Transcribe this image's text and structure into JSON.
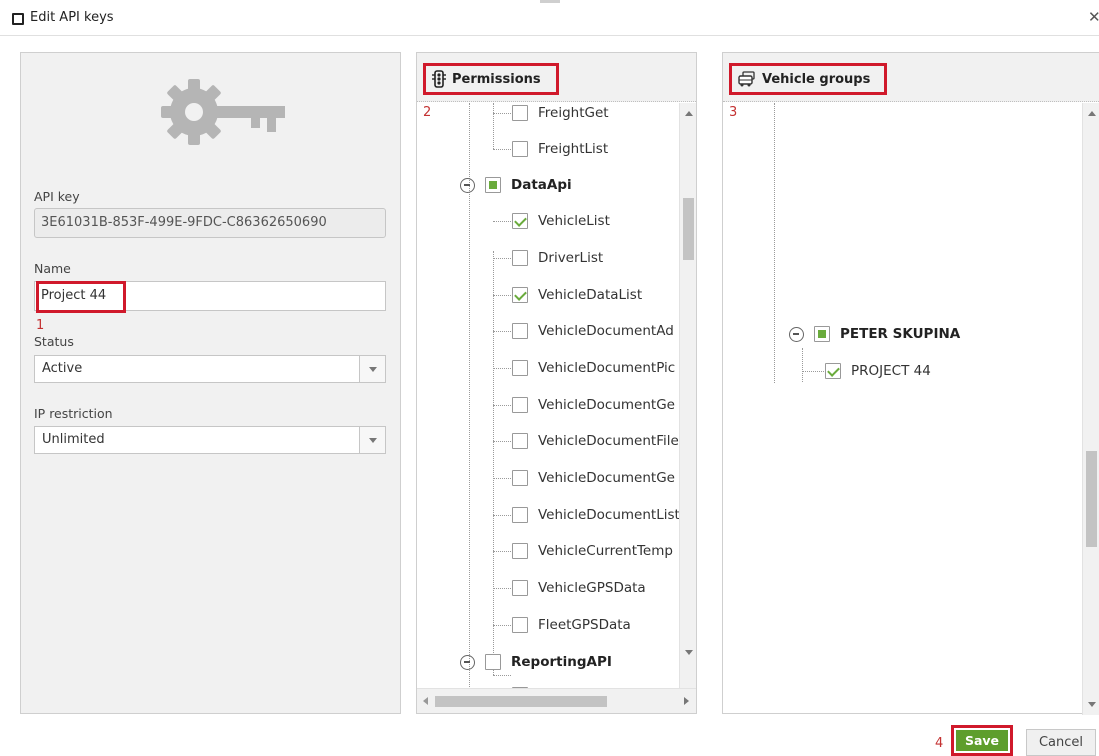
{
  "window": {
    "title": "Edit API keys"
  },
  "left": {
    "api_key_label": "API key",
    "api_key_value": "3E61031B-853F-499E-9FDC-C86362650690",
    "name_label": "Name",
    "name_value": "Project 44",
    "name_step": "1",
    "status_label": "Status",
    "status_value": "Active",
    "ip_label": "IP restriction",
    "ip_value": "Unlimited"
  },
  "permissions": {
    "title": "Permissions",
    "step": "2",
    "items": [
      {
        "label": "FreightGet",
        "state": "unchecked"
      },
      {
        "label": "FreightList",
        "state": "unchecked"
      },
      {
        "label": "DataApi",
        "state": "partial",
        "group": true
      },
      {
        "label": "VehicleList",
        "state": "checked"
      },
      {
        "label": "DriverList",
        "state": "unchecked"
      },
      {
        "label": "VehicleDataList",
        "state": "checked"
      },
      {
        "label": "VehicleDocumentAd",
        "state": "unchecked"
      },
      {
        "label": "VehicleDocumentPic",
        "state": "unchecked"
      },
      {
        "label": "VehicleDocumentGe",
        "state": "unchecked"
      },
      {
        "label": "VehicleDocumentFile",
        "state": "unchecked"
      },
      {
        "label": "VehicleDocumentGe",
        "state": "unchecked"
      },
      {
        "label": "VehicleDocumentList",
        "state": "unchecked"
      },
      {
        "label": "VehicleCurrentTemp",
        "state": "unchecked"
      },
      {
        "label": "VehicleGPSData",
        "state": "unchecked"
      },
      {
        "label": "FleetGPSData",
        "state": "unchecked"
      },
      {
        "label": "ReportingAPI",
        "state": "unchecked",
        "group": true
      }
    ]
  },
  "vehicle_groups": {
    "title": "Vehicle groups",
    "step": "3",
    "items": [
      {
        "label": "PETER SKUPINA",
        "state": "partial",
        "group": true
      },
      {
        "label": "PROJECT 44",
        "state": "checked"
      }
    ]
  },
  "footer": {
    "save_step": "4",
    "save_label": "Save",
    "cancel_label": "Cancel"
  },
  "colors": {
    "accent_green": "#5e9e2c",
    "highlight_red": "#d0192b",
    "check_green": "#6aab3c"
  }
}
